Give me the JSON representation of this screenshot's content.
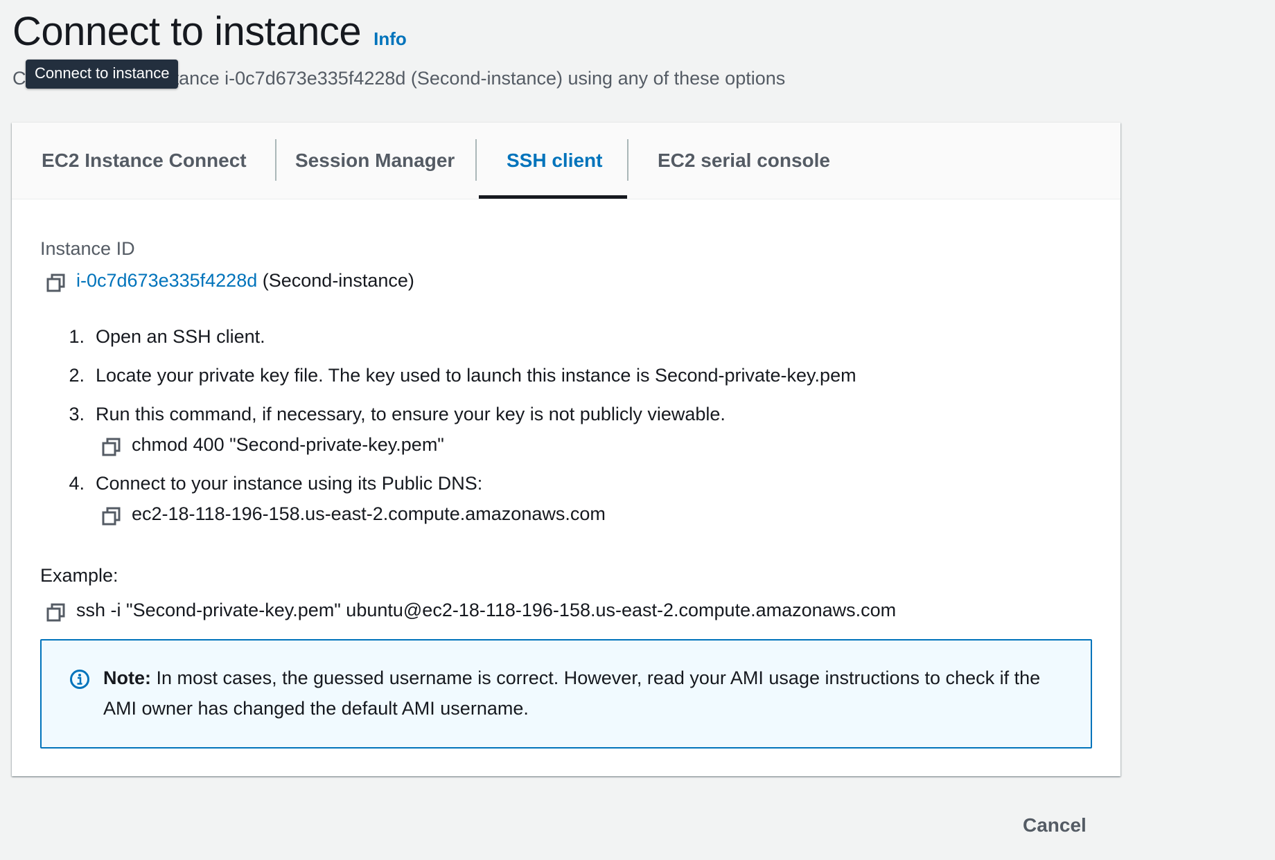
{
  "header": {
    "title": "Connect to instance",
    "info_label": "Info",
    "subtitle": "Connect to your instance i-0c7d673e335f4228d (Second-instance) using any of these options",
    "tooltip": "Connect to instance"
  },
  "tabs": [
    {
      "label": "EC2 Instance Connect",
      "active": false
    },
    {
      "label": "Session Manager",
      "active": false
    },
    {
      "label": "SSH client",
      "active": true
    },
    {
      "label": "EC2 serial console",
      "active": false
    }
  ],
  "instance": {
    "label": "Instance ID",
    "id": "i-0c7d673e335f4228d",
    "name": "(Second-instance)"
  },
  "steps": [
    {
      "number": "1.",
      "text": "Open an SSH client."
    },
    {
      "number": "2.",
      "text": "Locate your private key file. The key used to launch this instance is Second-private-key.pem"
    },
    {
      "number": "3.",
      "text": "Run this command, if necessary, to ensure your key is not publicly viewable.",
      "command": "chmod 400 \"Second-private-key.pem\""
    },
    {
      "number": "4.",
      "text": "Connect to your instance using its Public DNS:",
      "command": "ec2-18-118-196-158.us-east-2.compute.amazonaws.com"
    }
  ],
  "example": {
    "label": "Example:",
    "command": "ssh -i \"Second-private-key.pem\" ubuntu@ec2-18-118-196-158.us-east-2.compute.amazonaws.com"
  },
  "note": {
    "title": "Note:",
    "text": "In most cases, the guessed username is correct. However, read your AMI usage instructions to check if the AMI owner has changed the default AMI username."
  },
  "footer": {
    "cancel_label": "Cancel"
  },
  "colors": {
    "link": "#0073bb",
    "active_tab_underline": "#16191f",
    "note_background": "#f1faff",
    "tooltip_background": "#232f3e"
  },
  "icons": {
    "copy": "copy-icon",
    "info": "info-circle-icon"
  }
}
